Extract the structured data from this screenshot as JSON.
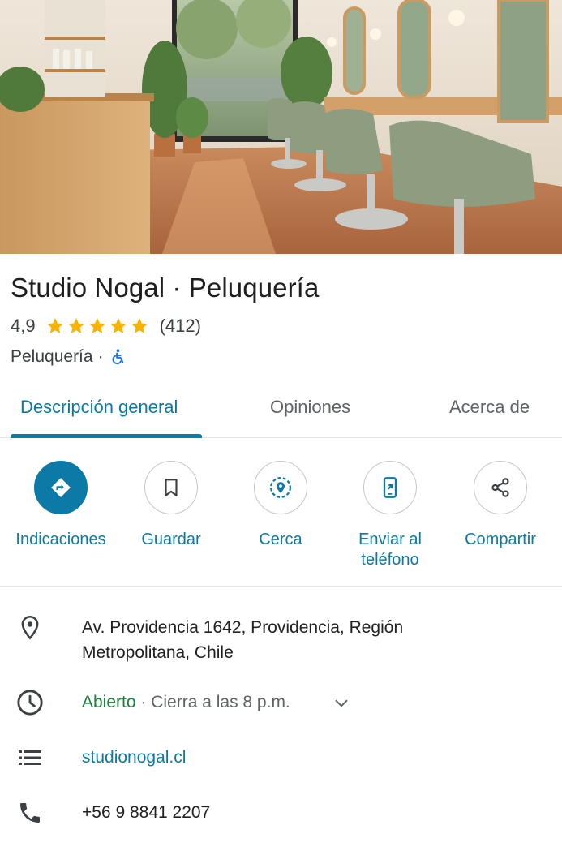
{
  "place": {
    "name": "Studio Nogal · Peluquería",
    "rating": "4,9",
    "stars": 5,
    "reviews": "(412)",
    "category": "Peluquería",
    "separator": "·"
  },
  "tabs": [
    {
      "label": "Descripción general",
      "active": true
    },
    {
      "label": "Opiniones",
      "active": false
    },
    {
      "label": "Acerca de",
      "active": false
    }
  ],
  "actions": [
    {
      "label": "Indicaciones",
      "icon": "directions-icon"
    },
    {
      "label": "Guardar",
      "icon": "bookmark-icon"
    },
    {
      "label": "Cerca",
      "icon": "nearby-icon"
    },
    {
      "label": "Enviar al teléfono",
      "icon": "send-to-phone-icon"
    },
    {
      "label": "Compartir",
      "icon": "share-icon"
    }
  ],
  "info": {
    "address": "Av. Providencia 1642, Providencia, Región Metropolitana, Chile",
    "open_status": "Abierto",
    "hours_detail": " · Cierra a las 8 p.m.",
    "website": "studionogal.cl",
    "phone": "+56 9 8841 2207"
  },
  "colors": {
    "accent": "#0b7aa7",
    "open": "#188038",
    "star": "#f6b400"
  }
}
